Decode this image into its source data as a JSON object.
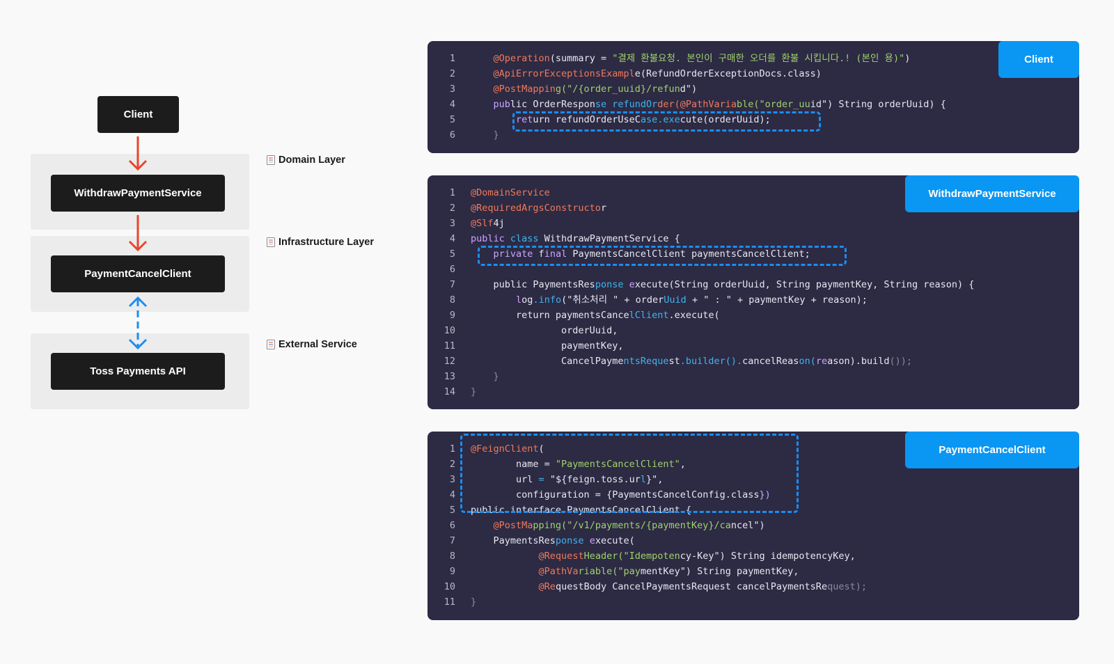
{
  "diagram": {
    "nodes": {
      "client": "Client",
      "withdraw_service": "WithdrawPaymentService",
      "cancel_client": "PaymentCancelClient",
      "toss_api": "Toss Payments API"
    },
    "layers": {
      "domain": "Domain Layer",
      "infrastructure": "Infrastructure Layer",
      "external": "External Service"
    },
    "colors": {
      "arrow": "#e8452c",
      "bidirectional": "#1d8ef0",
      "node_bg": "#1c1c1c",
      "panel_bg": "#ececec"
    }
  },
  "cards": [
    {
      "tag": "Client",
      "lines": [
        [
          {
            "t": "    "
          },
          {
            "t": "@Operation",
            "c": "ann"
          },
          {
            "t": "(summary = "
          },
          {
            "t": "\"결제 환불요청. 본인이 구매한 오더를 환불 시킵니다.! (본인 용)\"",
            "c": "str"
          },
          {
            "t": ")"
          }
        ],
        [
          {
            "t": "    "
          },
          {
            "t": "@ApiErrorExceptionsExampl",
            "c": "ann"
          },
          {
            "t": "e(RefundOrderExceptionDocs.class)"
          }
        ],
        [
          {
            "t": "    "
          },
          {
            "t": "@PostMappin",
            "c": "ann"
          },
          {
            "t": "g(\"/{order_uuid}/refun",
            "c": "str"
          },
          {
            "t": "d\")"
          }
        ],
        [
          {
            "t": "    "
          },
          {
            "t": "pub",
            "c": "kw"
          },
          {
            "t": "lic OrderRespon"
          },
          {
            "t": "se refundOr",
            "c": "fn"
          },
          {
            "t": "der(@PathVaria",
            "c": "ann"
          },
          {
            "t": "ble(\"order_uu",
            "c": "str"
          },
          {
            "t": "id\") String orderUuid) {"
          }
        ],
        [
          {
            "t": "        "
          },
          {
            "t": "ret",
            "c": "kw"
          },
          {
            "t": "urn refundOrderUseC"
          },
          {
            "t": "ase.exe",
            "c": "fn"
          },
          {
            "t": "cute(orderUuid);"
          }
        ],
        [
          {
            "t": "    "
          },
          {
            "t": "}",
            "c": "mut"
          }
        ]
      ]
    },
    {
      "tag": "WithdrawPaymentService",
      "lines": [
        [
          {
            "t": "@DomainService",
            "c": "ann"
          }
        ],
        [
          {
            "t": "@RequiredArgsConstructo",
            "c": "ann"
          },
          {
            "t": "r"
          }
        ],
        [
          {
            "t": "@Slf",
            "c": "ann"
          },
          {
            "t": "4j"
          }
        ],
        [
          {
            "t": "public ",
            "c": "kw"
          },
          {
            "t": "class",
            "c": "fn"
          },
          {
            "t": " WithdrawPaymentService {"
          }
        ],
        [
          {
            "t": "    "
          },
          {
            "t": "private",
            "c": "kw"
          },
          {
            "t": " f"
          },
          {
            "t": "inal",
            "c": "kw"
          },
          {
            "t": " PaymentsCancelClient paymentsCancelClient;"
          }
        ],
        [],
        [
          {
            "t": "    public PaymentsRes"
          },
          {
            "t": "ponse",
            "c": "fn"
          },
          {
            "t": " "
          },
          {
            "t": "e",
            "c": "kw"
          },
          {
            "t": "xecute(String orderUuid, String paymentKey, String reason) {"
          }
        ],
        [
          {
            "t": "        "
          },
          {
            "t": "l",
            "c": "kw"
          },
          {
            "t": "og"
          },
          {
            "t": ".info",
            "c": "fn"
          },
          {
            "t": "(\"취소처리 \" + order"
          },
          {
            "t": "Uuid",
            "c": "fn"
          },
          {
            "t": " + \" : \" + paymentKey + reason);"
          }
        ],
        [
          {
            "t": "        return paymentsCance"
          },
          {
            "t": "lClient",
            "c": "fn"
          },
          {
            "t": ".execute("
          }
        ],
        [
          {
            "t": "                orderUuid,"
          }
        ],
        [
          {
            "t": "                paymentKey,"
          }
        ],
        [
          {
            "t": "                CancelPayme"
          },
          {
            "t": "ntsReque",
            "c": "fn"
          },
          {
            "t": "st"
          },
          {
            "t": ".builder().",
            "c": "fn"
          },
          {
            "t": "cancelReas"
          },
          {
            "t": "on(",
            "c": "fn"
          },
          {
            "t": "re",
            "c": "kw"
          },
          {
            "t": "ason).build"
          },
          {
            "t": "());",
            "c": "mut"
          }
        ],
        [
          {
            "t": "    "
          },
          {
            "t": "}",
            "c": "mut"
          }
        ],
        [
          {
            "t": "}",
            "c": "mut"
          }
        ]
      ]
    },
    {
      "tag": "PaymentCancelClient",
      "lines": [
        [
          {
            "t": "@FeignClient",
            "c": "ann"
          },
          {
            "t": "("
          }
        ],
        [
          {
            "t": "        name = "
          },
          {
            "t": "\"PaymentsCancelClient\"",
            "c": "str"
          },
          {
            "t": ","
          }
        ],
        [
          {
            "t": "        url "
          },
          {
            "t": "=",
            "c": "fn"
          },
          {
            "t": " \"${feign.toss.ur"
          },
          {
            "t": "l",
            "c": "fn"
          },
          {
            "t": "}\","
          }
        ],
        [
          {
            "t": "        configuration = {PaymentsCancelConfig.class"
          },
          {
            "t": "})",
            "c": "kw"
          }
        ],
        [
          {
            "t": "public interface PaymentsCancelClient {"
          }
        ],
        [
          {
            "t": "    "
          },
          {
            "t": "@PostMa",
            "c": "ann"
          },
          {
            "t": "pping(\"/v1/payments/{paymentKey}/ca",
            "c": "str"
          },
          {
            "t": "ncel\")"
          }
        ],
        [
          {
            "t": "    PaymentsRes"
          },
          {
            "t": "ponse",
            "c": "fn"
          },
          {
            "t": " "
          },
          {
            "t": "e",
            "c": "kw"
          },
          {
            "t": "xecute("
          }
        ],
        [
          {
            "t": "            "
          },
          {
            "t": "@Request",
            "c": "ann"
          },
          {
            "t": "Header(\"Idempoten",
            "c": "str"
          },
          {
            "t": "cy-Key\") String idempotencyKey,"
          }
        ],
        [
          {
            "t": "            "
          },
          {
            "t": "@PathVa",
            "c": "ann"
          },
          {
            "t": "riable(\"pay",
            "c": "str"
          },
          {
            "t": "mentKey\") String paymentKey,"
          }
        ],
        [
          {
            "t": "            "
          },
          {
            "t": "@Re",
            "c": "ann"
          },
          {
            "t": "questBody CancelPaymentsRequest cancelPaymentsRe"
          },
          {
            "t": "quest);",
            "c": "mut"
          }
        ],
        [
          {
            "t": "}",
            "c": "mut"
          }
        ]
      ]
    }
  ]
}
